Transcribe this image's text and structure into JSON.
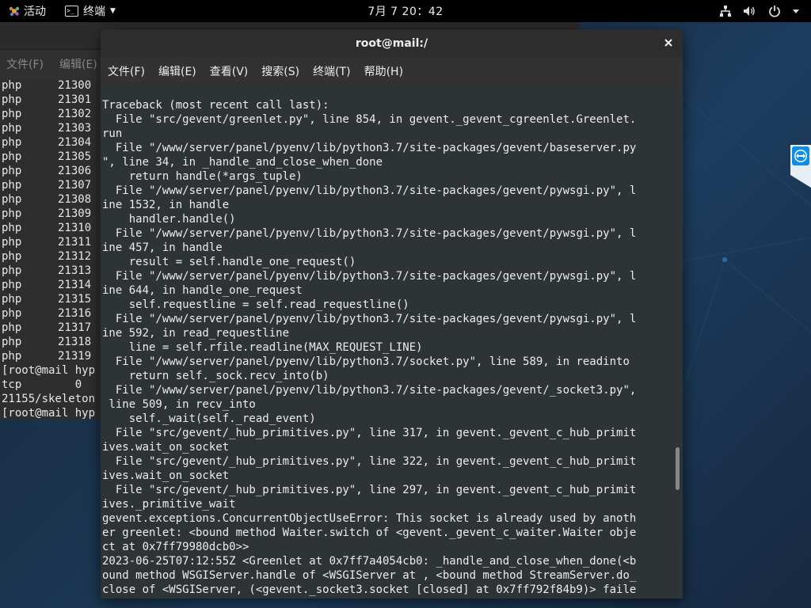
{
  "topbar": {
    "activities": "活动",
    "app_menu": "终端",
    "clock": "7月 7  20：42",
    "icons": [
      "network-icon",
      "volume-icon",
      "power-icon",
      "system-menu-caret-icon"
    ]
  },
  "bg_terminal": {
    "menu": [
      "文件(F)",
      "编辑(E)"
    ],
    "rows": [
      {
        "c1": "php",
        "c2": "21300"
      },
      {
        "c1": "php",
        "c2": "21301"
      },
      {
        "c1": "php",
        "c2": "21302"
      },
      {
        "c1": "php",
        "c2": "21303"
      },
      {
        "c1": "php",
        "c2": "21304"
      },
      {
        "c1": "php",
        "c2": "21305"
      },
      {
        "c1": "php",
        "c2": "21306"
      },
      {
        "c1": "php",
        "c2": "21307"
      },
      {
        "c1": "php",
        "c2": "21308"
      },
      {
        "c1": "php",
        "c2": "21309"
      },
      {
        "c1": "php",
        "c2": "21310"
      },
      {
        "c1": "php",
        "c2": "21311"
      },
      {
        "c1": "php",
        "c2": "21312"
      },
      {
        "c1": "php",
        "c2": "21313"
      },
      {
        "c1": "php",
        "c2": "21314"
      },
      {
        "c1": "php",
        "c2": "21315"
      },
      {
        "c1": "php",
        "c2": "21316"
      },
      {
        "c1": "php",
        "c2": "21317"
      },
      {
        "c1": "php",
        "c2": "21318"
      },
      {
        "c1": "php",
        "c2": "21319"
      }
    ],
    "tail": [
      "[root@mail hyp",
      "tcp        0",
      "21155/skeleton",
      "[root@mail hyp"
    ]
  },
  "main_terminal": {
    "title": "root@mail:/",
    "menu": [
      "文件(F)",
      "编辑(E)",
      "查看(V)",
      "搜索(S)",
      "终端(T)",
      "帮助(H)"
    ],
    "lines": [
      "Traceback (most recent call last):",
      "  File \"src/gevent/greenlet.py\", line 854, in gevent._gevent_cgreenlet.Greenlet.",
      "run",
      "  File \"/www/server/panel/pyenv/lib/python3.7/site-packages/gevent/baseserver.py",
      "\", line 34, in _handle_and_close_when_done",
      "    return handle(*args_tuple)",
      "  File \"/www/server/panel/pyenv/lib/python3.7/site-packages/gevent/pywsgi.py\", l",
      "ine 1532, in handle",
      "    handler.handle()",
      "  File \"/www/server/panel/pyenv/lib/python3.7/site-packages/gevent/pywsgi.py\", l",
      "ine 457, in handle",
      "    result = self.handle_one_request()",
      "  File \"/www/server/panel/pyenv/lib/python3.7/site-packages/gevent/pywsgi.py\", l",
      "ine 644, in handle_one_request",
      "    self.requestline = self.read_requestline()",
      "  File \"/www/server/panel/pyenv/lib/python3.7/site-packages/gevent/pywsgi.py\", l",
      "ine 592, in read_requestline",
      "    line = self.rfile.readline(MAX_REQUEST_LINE)",
      "  File \"/www/server/panel/pyenv/lib/python3.7/socket.py\", line 589, in readinto",
      "    return self._sock.recv_into(b)",
      "  File \"/www/server/panel/pyenv/lib/python3.7/site-packages/gevent/_socket3.py\",",
      " line 509, in recv_into",
      "    self._wait(self._read_event)",
      "  File \"src/gevent/_hub_primitives.py\", line 317, in gevent._gevent_c_hub_primit",
      "ives.wait_on_socket",
      "  File \"src/gevent/_hub_primitives.py\", line 322, in gevent._gevent_c_hub_primit",
      "ives.wait_on_socket",
      "  File \"src/gevent/_hub_primitives.py\", line 297, in gevent._gevent_c_hub_primit",
      "ives._primitive_wait",
      "gevent.exceptions.ConcurrentObjectUseError: This socket is already used by anoth",
      "er greenlet: <bound method Waiter.switch of <gevent._gevent_c_waiter.Waiter obje",
      "ct at 0x7ff79980dcb0>>",
      "2023-06-25T07:12:55Z <Greenlet at 0x7ff7a4054cb0: _handle_and_close_when_done(<b",
      "ound method WSGIServer.handle of <WSGIServer at , <bound method StreamServer.do_",
      "close of <WSGIServer, (<gevent._socket3.socket [closed] at 0x7ff792f84b9)> faile"
    ]
  },
  "colors": {
    "terminal_bg": "#2e3436",
    "topbar_bg": "#000000",
    "teamviewer_blue": "#0e8ee9"
  }
}
